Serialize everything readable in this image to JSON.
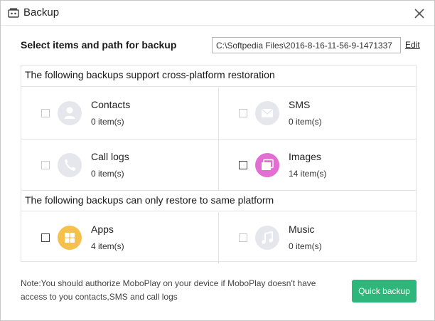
{
  "window": {
    "title": "Backup"
  },
  "header": {
    "label": "Select items and path for backup",
    "path_value": "C:\\Softpedia Files\\2016-8-16-11-56-9-1471337",
    "edit_label": "Edit"
  },
  "sections": [
    {
      "title": "The following backups support cross-platform restoration",
      "items": [
        {
          "name": "Contacts",
          "count": "0 item(s)",
          "icon": "contacts-icon",
          "checked": false
        },
        {
          "name": "SMS",
          "count": "0 item(s)",
          "icon": "sms-icon",
          "checked": false
        },
        {
          "name": "Call logs",
          "count": "0 item(s)",
          "icon": "phone-icon",
          "checked": false
        },
        {
          "name": "Images",
          "count": "14 item(s)",
          "icon": "images-icon",
          "checked": false
        }
      ]
    },
    {
      "title": "The following backups can only restore to same platform",
      "items": [
        {
          "name": "Apps",
          "count": "4 item(s)",
          "icon": "apps-icon",
          "checked": false
        },
        {
          "name": "Music",
          "count": "0 item(s)",
          "icon": "music-icon",
          "checked": false
        }
      ]
    }
  ],
  "footer": {
    "note_line1": "Note:You should authorize MoboPlay on your device if MoboPlay doesn't have",
    "note_line2": "access to you contacts,SMS and call logs",
    "button_label": "Quick backup"
  },
  "colors": {
    "accent_green": "#2fb67b",
    "images_pink": "#e46dd4",
    "apps_yellow": "#f6c04c",
    "icon_gray": "#e5e7ec"
  }
}
